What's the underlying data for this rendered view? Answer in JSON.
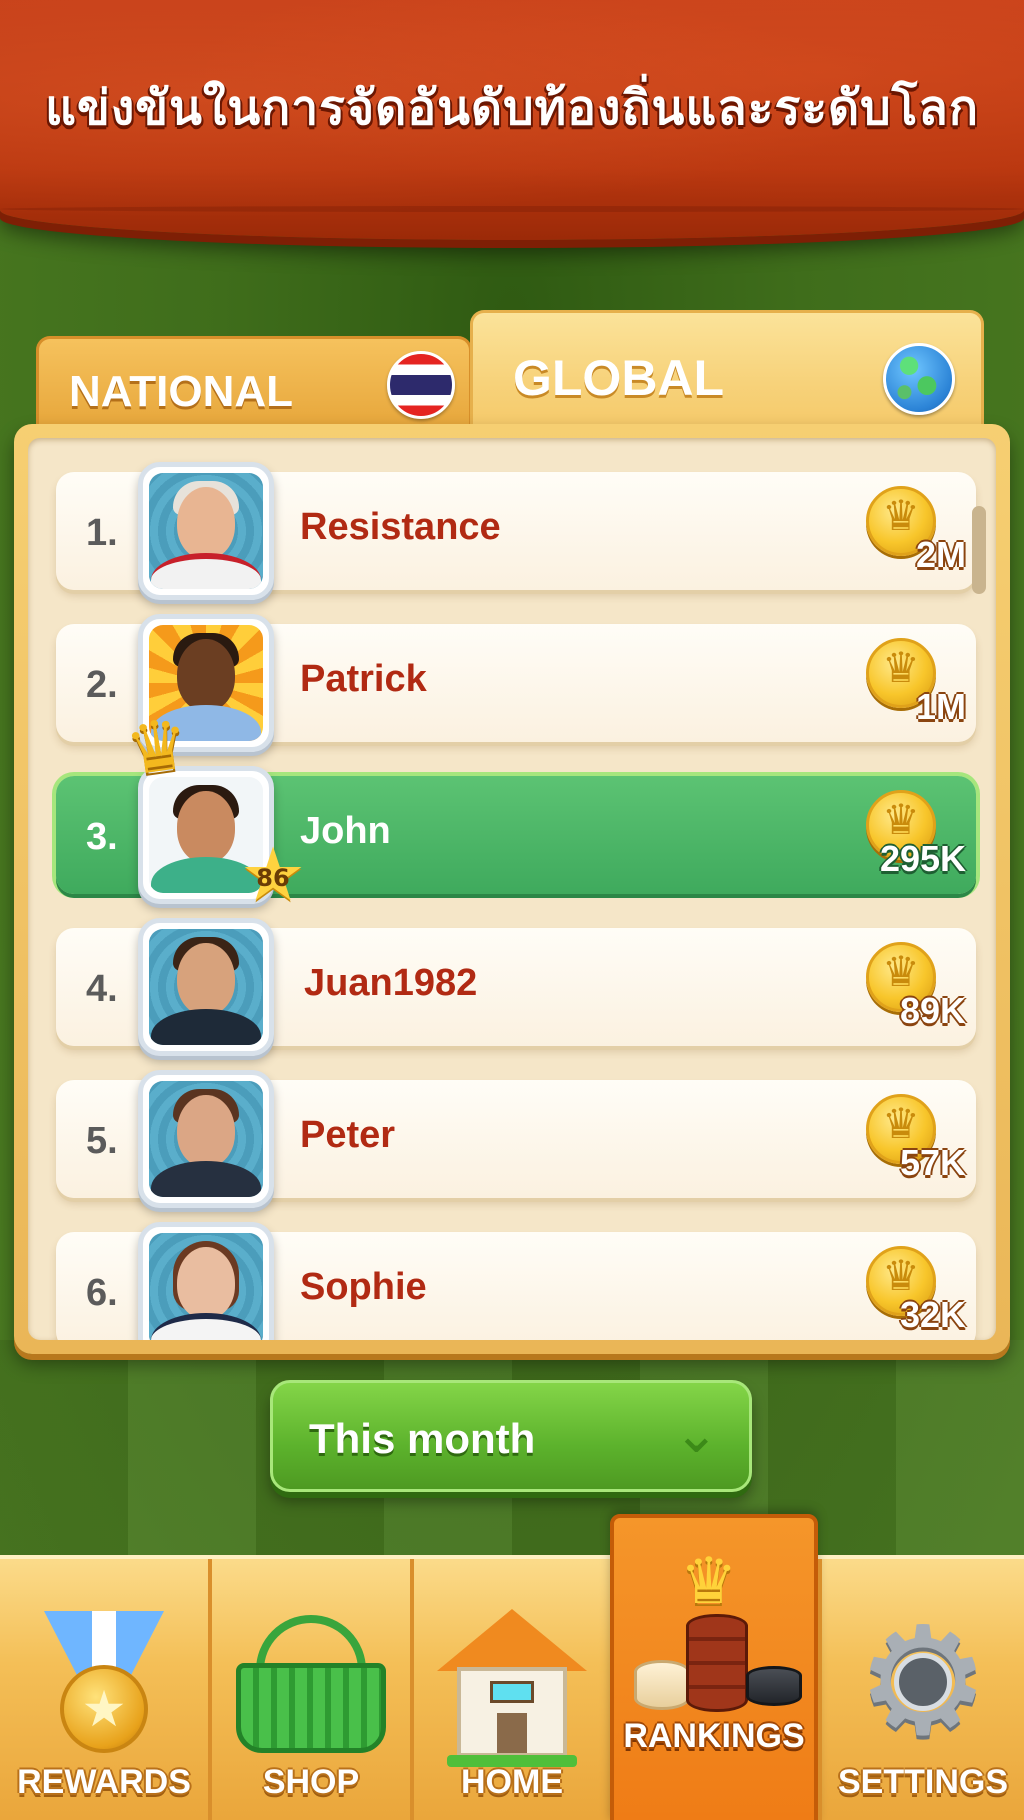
{
  "banner": {
    "title": "แข่งขันในการจัดอันดับท้องถิ่นและระดับโลก"
  },
  "tabs": {
    "national": {
      "label": "NATIONAL",
      "flag": "thailand-flag"
    },
    "global": {
      "label": "GLOBAL",
      "icon": "globe-icon",
      "active": true
    }
  },
  "leaderboard": {
    "rows": [
      {
        "rank": "1.",
        "name": "Resistance",
        "score": "2M",
        "avatar": "old-man-glasses"
      },
      {
        "rank": "2.",
        "name": "Patrick",
        "score": "1M",
        "avatar": "bearded-man"
      },
      {
        "rank": "3.",
        "name": "John",
        "score": "295K",
        "avatar": "smiling-young-man",
        "is_current_user": true,
        "level": "86"
      },
      {
        "rank": "4.",
        "name": "Juan1982",
        "score": "89K",
        "avatar": "dark-haired-man"
      },
      {
        "rank": "5.",
        "name": "Peter",
        "score": "57K",
        "avatar": "brown-haired-man"
      },
      {
        "rank": "6.",
        "name": "Sophie",
        "score": "32K",
        "avatar": "woman"
      }
    ]
  },
  "period": {
    "label": "This month"
  },
  "nav": {
    "items": [
      {
        "label": "REWARDS",
        "icon": "medal-icon"
      },
      {
        "label": "SHOP",
        "icon": "basket-icon"
      },
      {
        "label": "HOME",
        "icon": "house-icon"
      },
      {
        "label": "RANKINGS",
        "icon": "checkers-pieces-icon",
        "active": true
      },
      {
        "label": "SETTINGS",
        "icon": "gear-icon"
      }
    ]
  },
  "colors": {
    "banner_red": "#c7411a",
    "panel_gold": "#f6cf72",
    "highlight_green": "#4fb466",
    "name_red": "#b12a13",
    "nav_active_orange": "#f0841c"
  }
}
